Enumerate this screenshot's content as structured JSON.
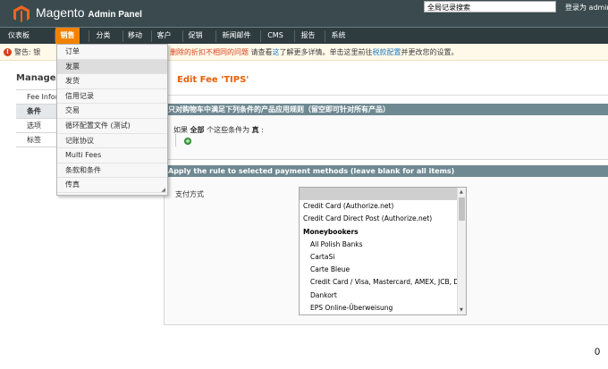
{
  "header": {
    "logo_text": "Magento",
    "admin_panel": "Admin Panel",
    "search_placeholder": "全局记录搜索",
    "login_info": "登录为 admin"
  },
  "nav": [
    {
      "label": "仪表板"
    },
    {
      "label": "销售",
      "active": true
    },
    {
      "label": "分类"
    },
    {
      "label": "移动"
    },
    {
      "label": "客户"
    },
    {
      "label": "促销"
    },
    {
      "label": "新闻邮件"
    },
    {
      "label": "CMS"
    },
    {
      "label": "报告"
    },
    {
      "label": "系统"
    }
  ],
  "warning": {
    "left": "警告: 银",
    "right_a": "删除的折扣不相同的问题",
    "right_b": "请查看",
    "right_link1": "这",
    "right_c": "了解更多详情。单击这里前往",
    "right_link2": "税款配置",
    "right_d": "并更改您的设置。"
  },
  "dropdown": [
    {
      "label": "订单"
    },
    {
      "label": "发票",
      "hover": true
    },
    {
      "label": "发货"
    },
    {
      "label": "信用记录"
    },
    {
      "label": "交易"
    },
    {
      "label": "循环配置文件 (测试)"
    },
    {
      "label": "记账协议"
    },
    {
      "label": "Multi Fees"
    },
    {
      "label": "条款和条件"
    },
    {
      "label": "传真"
    }
  ],
  "left": {
    "title": "Manage F",
    "tabs": [
      {
        "label": "Fee Infor"
      },
      {
        "label": "条件",
        "active": true
      },
      {
        "label": "选项"
      },
      {
        "label": "标签"
      }
    ]
  },
  "content": {
    "title": "Edit Fee 'TIPS'",
    "section1_title": "只对购物车中满足下列条件的产品应用规则（留空即可针对所有产品）",
    "condition_prefix": "如果",
    "condition_all": "全部",
    "condition_mid": "个这些条件为",
    "condition_true": "真",
    "condition_suffix": ":",
    "section2_title": "Apply the rule to selected payment methods (leave blank for all items)",
    "payment_label": "支付方式",
    "payment_options": [
      {
        "label": "",
        "kind": "first"
      },
      {
        "label": "Credit Card (Authorize.net)"
      },
      {
        "label": "Credit Card Direct Post (Authorize.net)"
      },
      {
        "label": "Moneybookers",
        "kind": "group"
      },
      {
        "label": "All Polish Banks",
        "kind": "indent"
      },
      {
        "label": "CartaSi",
        "kind": "indent"
      },
      {
        "label": "Carte Bleue",
        "kind": "indent"
      },
      {
        "label": "Credit Card / Visa, Mastercard, AMEX, JCB, D",
        "kind": "indent"
      },
      {
        "label": "Dankort",
        "kind": "indent"
      },
      {
        "label": "EPS Online-Überweisung",
        "kind": "indent"
      },
      {
        "label": "",
        "kind": "indent"
      }
    ]
  },
  "corner_text": "0",
  "colors": {
    "header_bg": "#3a4a4f",
    "nav_active": "#f18200",
    "section_head": "#6f8992",
    "title_orange": "#eb5e00"
  }
}
